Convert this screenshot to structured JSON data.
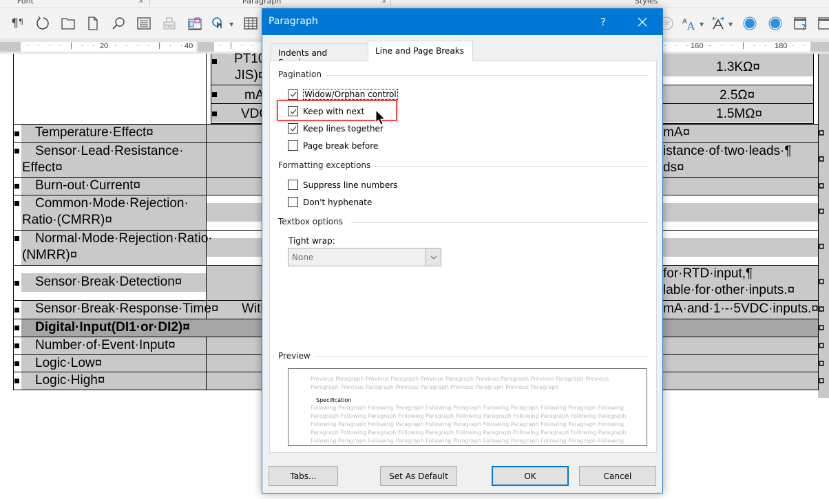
{
  "ribbon": {
    "groups": [
      {
        "label": "Font"
      },
      {
        "label": "Paragraph"
      },
      {
        "label": "Styles"
      }
    ],
    "toolbar_icons": [
      "show-formatting-marks-icon",
      "refresh-icon",
      "folder-icon",
      "new-document-icon",
      "search-icon",
      "text-lines-icon",
      "png-export-icon",
      "3d-objects-icon",
      "touch-mode-icon",
      "table-icon"
    ],
    "right_icons": [
      "chinese-char-icon",
      "font-size-icon",
      "text-direction-icon",
      "circle-blue-icon-1",
      "circle-blue-icon-2",
      "calendar-help-icon",
      "window-icon"
    ]
  },
  "ruler": {
    "labels": [
      "20",
      "40",
      "160",
      "180"
    ]
  },
  "document": {
    "top_sub_rows": [
      {
        "left": "PT10",
        "left2": "JIS)¤",
        "right": "1.3KΩ¤"
      },
      {
        "left": "mA",
        "right": "2.5Ω¤"
      },
      {
        "left": "VDC",
        "right": "1.5MΩ¤"
      }
    ],
    "rows": [
      {
        "label": "Temperature·Effect¤",
        "right": "mA¤"
      },
      {
        "label": "Sensor·Lead·Resistance·",
        "label2": "Effect¤",
        "right": "istance·of·two·leads·¶",
        "right2": "ds¤"
      },
      {
        "label": "Burn-out·Current¤",
        "right": ""
      },
      {
        "label": "Common·Mode·Rejection·",
        "label2": "Ratio·(CMRR)¤",
        "right": ""
      },
      {
        "label": "Normal·Mode·Rejection·Ratio·",
        "label2": "(NMRR)¤",
        "right": ""
      },
      {
        "label": "Sensor·Break·Detection¤",
        "right": "for·RTD·input,¶",
        "right2": "lable·for·other·inputs.¤"
      },
      {
        "label": "Sensor·Break·Response·Time¤",
        "mid": "With",
        "right": "mA·and·1·-·5VDC·inputs.¤"
      },
      {
        "label": "Digital·Input(DI1·or·DI2)¤",
        "header": true
      },
      {
        "label": "Number·of·Event·Input¤"
      },
      {
        "label": "Logic·Low¤"
      },
      {
        "label": "Logic·High¤"
      }
    ],
    "cell_end_mark": "¤"
  },
  "dialog": {
    "title": "Paragraph",
    "help_label": "?",
    "tabs": [
      {
        "label": "Indents and Spacing",
        "active": false
      },
      {
        "label": "Line and Page Breaks",
        "active": true
      }
    ],
    "sections": {
      "pagination": {
        "label": "Pagination",
        "options": [
          {
            "label": "Widow/Orphan control",
            "checked": true
          },
          {
            "label": "Keep with next",
            "checked": true,
            "highlighted": true
          },
          {
            "label": "Keep lines together",
            "checked": true
          },
          {
            "label": "Page break before",
            "checked": false
          }
        ]
      },
      "formatting_exceptions": {
        "label": "Formatting exceptions",
        "options": [
          {
            "label": "Suppress line numbers",
            "checked": false
          },
          {
            "label": "Don't hyphenate",
            "checked": false
          }
        ]
      },
      "textbox_options": {
        "label": "Textbox options",
        "tight_wrap_label": "Tight wrap:",
        "tight_wrap_value": "None"
      },
      "preview": {
        "label": "Preview",
        "previous_lines": [
          "Previous Paragraph Previous Paragraph Previous Paragraph Previous Paragraph Previous Paragraph Previous",
          "Paragraph Previous Paragraph Previous Paragraph Previous Paragraph Previous Paragraph"
        ],
        "current": "Specification",
        "following_lines": [
          "Following Paragraph Following Paragraph Following Paragraph Following Paragraph Following Paragraph Following",
          "Paragraph Following Paragraph Following Paragraph Following Paragraph Following Paragraph Following Paragraph",
          "Following Paragraph Following Paragraph Following Paragraph Following Paragraph Following Paragraph Following",
          "Paragraph Following Paragraph Following Paragraph Following Paragraph Following Paragraph Following Paragraph",
          "Following Paragraph Following Paragraph Following Paragraph Following Paragraph Following Paragraph Following"
        ]
      }
    },
    "buttons": {
      "tabs": "Tabs...",
      "set_default": "Set As Default",
      "ok": "OK",
      "cancel": "Cancel"
    }
  },
  "colors": {
    "titlebar": "#0078d7",
    "highlight": "#e05050",
    "cell_gray": "#c9c9c9",
    "header_gray": "#a6a6a6"
  }
}
